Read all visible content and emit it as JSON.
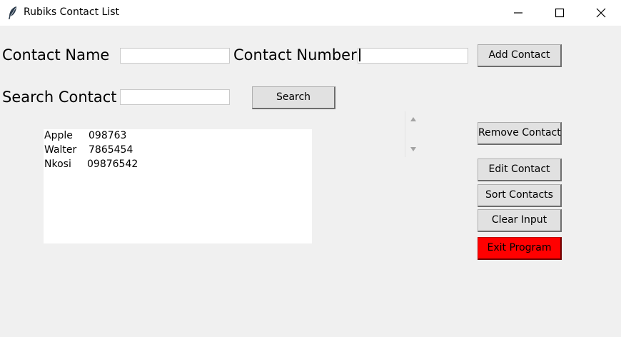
{
  "window": {
    "title": "Rubiks Contact List",
    "icon": "feather-icon"
  },
  "form": {
    "name_label": "Contact Name",
    "name_value": "",
    "number_label": "Contact Number",
    "number_value": "",
    "search_label": "Search Contact",
    "search_value": ""
  },
  "buttons": {
    "add": "Add Contact",
    "search": "Search",
    "remove": "Remove Contact",
    "edit": "Edit Contact",
    "sort": "Sort Contacts",
    "clear": "Clear Input",
    "exit": "Exit Program"
  },
  "colors": {
    "exit_button": "#ff0000",
    "background": "#f0f0f0"
  },
  "contacts": [
    {
      "name": "Apple",
      "number": "098763"
    },
    {
      "name": "Walter",
      "number": "7865454"
    },
    {
      "name": "Nkosi",
      "number": "09876542"
    }
  ]
}
